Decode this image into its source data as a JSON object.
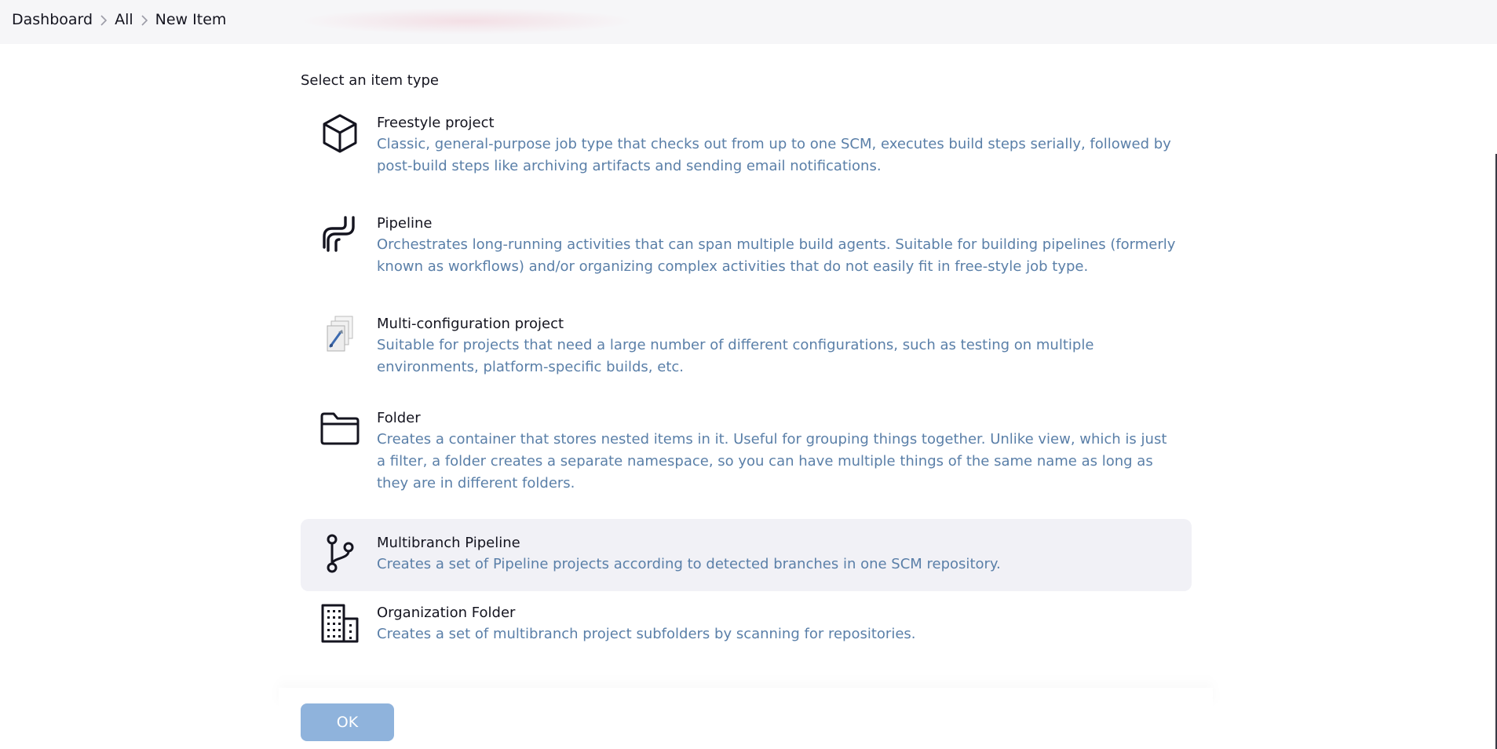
{
  "breadcrumb": {
    "items": [
      "Dashboard",
      "All",
      "New Item"
    ]
  },
  "main": {
    "section_title": "Select an item type",
    "items": [
      {
        "title": "Freestyle project",
        "description": "Classic, general-purpose job type that checks out from up to one SCM, executes build steps serially, followed by post-build steps like archiving artifacts and sending email notifications.",
        "icon": "cube-icon",
        "selected": false
      },
      {
        "title": "Pipeline",
        "description": "Orchestrates long-running activities that can span multiple build agents. Suitable for building pipelines (formerly known as workflows) and/or organizing complex activities that do not easily fit in free-style job type.",
        "icon": "pipeline-icon",
        "selected": false
      },
      {
        "title": "Multi-configuration project",
        "description": "Suitable for projects that need a large number of different configurations, such as testing on multiple environments, platform-specific builds, etc.",
        "icon": "multi-config-icon",
        "selected": false
      },
      {
        "title": "Folder",
        "description": "Creates a container that stores nested items in it. Useful for grouping things together. Unlike view, which is just a filter, a folder creates a separate namespace, so you can have multiple things of the same name as long as they are in different folders.",
        "icon": "folder-icon",
        "selected": false
      },
      {
        "title": "Multibranch Pipeline",
        "description": "Creates a set of Pipeline projects according to detected branches in one SCM repository.",
        "icon": "branch-icon",
        "selected": true
      },
      {
        "title": "Organization Folder",
        "description": "Creates a set of multibranch project subfolders by scanning for repositories.",
        "icon": "building-icon",
        "selected": false
      }
    ]
  },
  "footer": {
    "ok_label": "OK"
  },
  "colors": {
    "accent": "#8fb3dc",
    "description_text": "#5a7fa8",
    "selected_background": "#f1f1f6",
    "topbar_background": "#f6f6f8"
  }
}
